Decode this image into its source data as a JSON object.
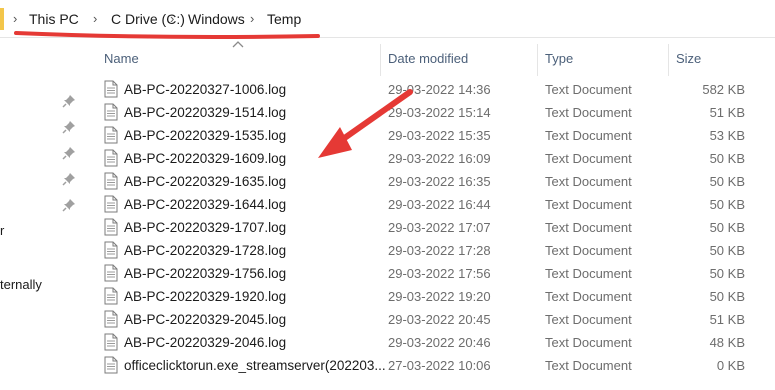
{
  "address_bar": {
    "crumbs": [
      "This PC",
      "C Drive (C:)",
      "Windows",
      "Temp"
    ]
  },
  "sidebar": {
    "labels": [
      "r",
      "ternally"
    ]
  },
  "columns": {
    "name": "Name",
    "date": "Date modified",
    "type": "Type",
    "size": "Size"
  },
  "files": [
    {
      "name": "AB-PC-20220327-1006.log",
      "date": "29-03-2022 14:36",
      "type": "Text Document",
      "size": "582 KB"
    },
    {
      "name": "AB-PC-20220329-1514.log",
      "date": "29-03-2022 15:14",
      "type": "Text Document",
      "size": "51 KB"
    },
    {
      "name": "AB-PC-20220329-1535.log",
      "date": "29-03-2022 15:35",
      "type": "Text Document",
      "size": "53 KB"
    },
    {
      "name": "AB-PC-20220329-1609.log",
      "date": "29-03-2022 16:09",
      "type": "Text Document",
      "size": "50 KB"
    },
    {
      "name": "AB-PC-20220329-1635.log",
      "date": "29-03-2022 16:35",
      "type": "Text Document",
      "size": "50 KB"
    },
    {
      "name": "AB-PC-20220329-1644.log",
      "date": "29-03-2022 16:44",
      "type": "Text Document",
      "size": "50 KB"
    },
    {
      "name": "AB-PC-20220329-1707.log",
      "date": "29-03-2022 17:07",
      "type": "Text Document",
      "size": "50 KB"
    },
    {
      "name": "AB-PC-20220329-1728.log",
      "date": "29-03-2022 17:28",
      "type": "Text Document",
      "size": "50 KB"
    },
    {
      "name": "AB-PC-20220329-1756.log",
      "date": "29-03-2022 17:56",
      "type": "Text Document",
      "size": "50 KB"
    },
    {
      "name": "AB-PC-20220329-1920.log",
      "date": "29-03-2022 19:20",
      "type": "Text Document",
      "size": "50 KB"
    },
    {
      "name": "AB-PC-20220329-2045.log",
      "date": "29-03-2022 20:45",
      "type": "Text Document",
      "size": "51 KB"
    },
    {
      "name": "AB-PC-20220329-2046.log",
      "date": "29-03-2022 20:46",
      "type": "Text Document",
      "size": "48 KB"
    },
    {
      "name": "officeclicktorun.exe_streamserver(202203...",
      "date": "27-03-2022 10:06",
      "type": "Text Document",
      "size": "0 KB"
    }
  ],
  "colors": {
    "annotation": "#e53935",
    "header_text": "#4c607a",
    "muted_text": "#6d6d6d"
  }
}
